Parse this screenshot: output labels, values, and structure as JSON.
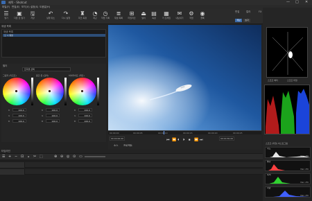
{
  "window": {
    "title": "제목 - Shotcut",
    "controls": [
      "—",
      "□",
      "✕"
    ]
  },
  "menu": [
    "파일(F)",
    "편집(E)",
    "보기(V)",
    "설정(S)",
    "도움말(H)"
  ],
  "toolbar": [
    {
      "icon": "☰",
      "label": "열기"
    },
    {
      "icon": "▣",
      "label": "다른 것 열기"
    },
    {
      "icon": "🖫",
      "label": "저장"
    },
    {
      "icon": "↶",
      "label": "실행 취소"
    },
    {
      "icon": "↷",
      "label": "다시 실행"
    },
    {
      "icon": "♜",
      "label": "피크 측정"
    },
    {
      "icon": "◔",
      "label": "최근"
    },
    {
      "icon": "◷",
      "label": "작업 기록"
    },
    {
      "icon": "≣",
      "label": "재생 목록"
    },
    {
      "icon": "⊞",
      "label": "타임라인"
    },
    {
      "icon": "⏏",
      "label": "필터"
    },
    {
      "icon": "▤",
      "label": "속성"
    },
    {
      "icon": "▦",
      "label": "키 프레임"
    },
    {
      "icon": "✉",
      "label": "내보내기"
    },
    {
      "icon": "⚙",
      "label": "작업"
    },
    {
      "icon": "◉",
      "label": "클록"
    }
  ],
  "layout_tabs": [
    "편집",
    "컬러",
    "FX"
  ],
  "layout_buttons": [
    "색상",
    "효과"
  ],
  "playlist": {
    "header": "재생 목록",
    "selected_row": "오 시 평원"
  },
  "filters": {
    "header": "필터",
    "mode_label": "프리셋 선택",
    "wheels": [
      {
        "label": "그림자 (리프트)",
        "dot_color": "#e05a3a",
        "values": {
          "R": "100.0",
          "G": "100.0",
          "B": "100.0"
        }
      },
      {
        "label": "중간 톤 (감마)",
        "dot_color": "#e05a3a",
        "values": {
          "R": "100.0",
          "G": "100.0",
          "B": "100.0"
        }
      },
      {
        "label": "하이라이트 (게인)",
        "dot_color": "#e05a3a",
        "values": {
          "R": "100.0",
          "G": "100.0",
          "B": "100.0"
        }
      }
    ]
  },
  "viewer": {
    "description": "aerial boat on sea"
  },
  "ruler": [
    "00:00:00",
    "00:00:05",
    "00:00:10",
    "00:00:15",
    "00:00:20",
    "00:00:25",
    "00:00:30"
  ],
  "transport": {
    "timecode_current": "00:00:00;00",
    "timecode_total": "00:00:30;00",
    "source_label": "소스",
    "project_label": "프로젝트",
    "buttons": [
      "⏮",
      "⏪",
      "⏴",
      "⏵",
      "⏹",
      "⏩",
      "⏭"
    ]
  },
  "scopes": {
    "tabs": [
      "스코프 벡터",
      "스코프 파형"
    ],
    "histogram_header": "스코프 (파형) 히스토그램",
    "histogram_bars": [
      {
        "name": "휘도",
        "color": "#ffffff",
        "min": "Min: 0",
        "max": "Max: 255"
      },
      {
        "name": "빨강",
        "color": "#ff4040",
        "min": "Min: 0",
        "max": "Max: 255"
      },
      {
        "name": "녹색",
        "color": "#30d030",
        "min": "Min: 0",
        "max": "Max: 255"
      },
      {
        "name": "파랑",
        "color": "#4060ff",
        "min": "Min: 0",
        "max": "Max: 255"
      }
    ]
  },
  "timeline": {
    "header": "타임라인",
    "tools": [
      "☰",
      "+",
      "−",
      "⊡",
      "⌅",
      "✂",
      "⬚",
      "⊕",
      "⊖",
      "◎",
      "⊙",
      "▭"
    ]
  },
  "colors": {
    "accent": "#3b6aa8",
    "ocean_deep": "#0f2d5c",
    "ocean_light": "#6aa6e0"
  }
}
